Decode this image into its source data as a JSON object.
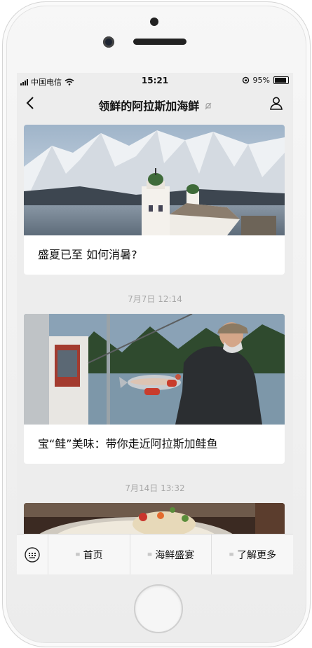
{
  "status_bar": {
    "carrier": "中国电信",
    "time": "15:21",
    "battery": "95%"
  },
  "header": {
    "title": "领鲜的阿拉斯加海鲜"
  },
  "feed": {
    "articles": [
      {
        "title": "盛夏已至 如何消暑?"
      },
      {
        "timestamp": "7月7日 12:14",
        "title": "宝“鲑”美味：带你走近阿拉斯加鲑鱼"
      },
      {
        "timestamp": "7月14日 13:32"
      }
    ]
  },
  "bottom_menu": {
    "items": [
      {
        "label": "首页"
      },
      {
        "label": "海鲜盛宴"
      },
      {
        "label": "了解更多"
      }
    ]
  },
  "colors": {
    "background": "#ededed",
    "card": "#ffffff",
    "timestamp": "#a7a7a7"
  },
  "icons": [
    "back-arrow-icon",
    "mute-icon",
    "person-icon",
    "keyboard-icon",
    "menu-icon",
    "signal-icon",
    "wifi-icon",
    "battery-icon"
  ]
}
